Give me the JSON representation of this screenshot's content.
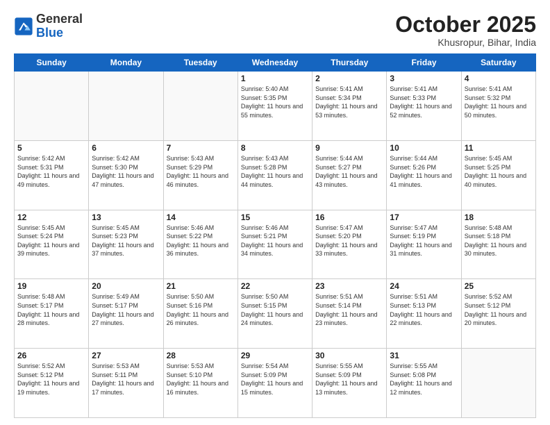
{
  "header": {
    "logo_general": "General",
    "logo_blue": "Blue",
    "month": "October 2025",
    "location": "Khusropur, Bihar, India"
  },
  "days_of_week": [
    "Sunday",
    "Monday",
    "Tuesday",
    "Wednesday",
    "Thursday",
    "Friday",
    "Saturday"
  ],
  "weeks": [
    [
      {
        "day": "",
        "info": ""
      },
      {
        "day": "",
        "info": ""
      },
      {
        "day": "",
        "info": ""
      },
      {
        "day": "1",
        "info": "Sunrise: 5:40 AM\nSunset: 5:35 PM\nDaylight: 11 hours\nand 55 minutes."
      },
      {
        "day": "2",
        "info": "Sunrise: 5:41 AM\nSunset: 5:34 PM\nDaylight: 11 hours\nand 53 minutes."
      },
      {
        "day": "3",
        "info": "Sunrise: 5:41 AM\nSunset: 5:33 PM\nDaylight: 11 hours\nand 52 minutes."
      },
      {
        "day": "4",
        "info": "Sunrise: 5:41 AM\nSunset: 5:32 PM\nDaylight: 11 hours\nand 50 minutes."
      }
    ],
    [
      {
        "day": "5",
        "info": "Sunrise: 5:42 AM\nSunset: 5:31 PM\nDaylight: 11 hours\nand 49 minutes."
      },
      {
        "day": "6",
        "info": "Sunrise: 5:42 AM\nSunset: 5:30 PM\nDaylight: 11 hours\nand 47 minutes."
      },
      {
        "day": "7",
        "info": "Sunrise: 5:43 AM\nSunset: 5:29 PM\nDaylight: 11 hours\nand 46 minutes."
      },
      {
        "day": "8",
        "info": "Sunrise: 5:43 AM\nSunset: 5:28 PM\nDaylight: 11 hours\nand 44 minutes."
      },
      {
        "day": "9",
        "info": "Sunrise: 5:44 AM\nSunset: 5:27 PM\nDaylight: 11 hours\nand 43 minutes."
      },
      {
        "day": "10",
        "info": "Sunrise: 5:44 AM\nSunset: 5:26 PM\nDaylight: 11 hours\nand 41 minutes."
      },
      {
        "day": "11",
        "info": "Sunrise: 5:45 AM\nSunset: 5:25 PM\nDaylight: 11 hours\nand 40 minutes."
      }
    ],
    [
      {
        "day": "12",
        "info": "Sunrise: 5:45 AM\nSunset: 5:24 PM\nDaylight: 11 hours\nand 39 minutes."
      },
      {
        "day": "13",
        "info": "Sunrise: 5:45 AM\nSunset: 5:23 PM\nDaylight: 11 hours\nand 37 minutes."
      },
      {
        "day": "14",
        "info": "Sunrise: 5:46 AM\nSunset: 5:22 PM\nDaylight: 11 hours\nand 36 minutes."
      },
      {
        "day": "15",
        "info": "Sunrise: 5:46 AM\nSunset: 5:21 PM\nDaylight: 11 hours\nand 34 minutes."
      },
      {
        "day": "16",
        "info": "Sunrise: 5:47 AM\nSunset: 5:20 PM\nDaylight: 11 hours\nand 33 minutes."
      },
      {
        "day": "17",
        "info": "Sunrise: 5:47 AM\nSunset: 5:19 PM\nDaylight: 11 hours\nand 31 minutes."
      },
      {
        "day": "18",
        "info": "Sunrise: 5:48 AM\nSunset: 5:18 PM\nDaylight: 11 hours\nand 30 minutes."
      }
    ],
    [
      {
        "day": "19",
        "info": "Sunrise: 5:48 AM\nSunset: 5:17 PM\nDaylight: 11 hours\nand 28 minutes."
      },
      {
        "day": "20",
        "info": "Sunrise: 5:49 AM\nSunset: 5:17 PM\nDaylight: 11 hours\nand 27 minutes."
      },
      {
        "day": "21",
        "info": "Sunrise: 5:50 AM\nSunset: 5:16 PM\nDaylight: 11 hours\nand 26 minutes."
      },
      {
        "day": "22",
        "info": "Sunrise: 5:50 AM\nSunset: 5:15 PM\nDaylight: 11 hours\nand 24 minutes."
      },
      {
        "day": "23",
        "info": "Sunrise: 5:51 AM\nSunset: 5:14 PM\nDaylight: 11 hours\nand 23 minutes."
      },
      {
        "day": "24",
        "info": "Sunrise: 5:51 AM\nSunset: 5:13 PM\nDaylight: 11 hours\nand 22 minutes."
      },
      {
        "day": "25",
        "info": "Sunrise: 5:52 AM\nSunset: 5:12 PM\nDaylight: 11 hours\nand 20 minutes."
      }
    ],
    [
      {
        "day": "26",
        "info": "Sunrise: 5:52 AM\nSunset: 5:12 PM\nDaylight: 11 hours\nand 19 minutes."
      },
      {
        "day": "27",
        "info": "Sunrise: 5:53 AM\nSunset: 5:11 PM\nDaylight: 11 hours\nand 17 minutes."
      },
      {
        "day": "28",
        "info": "Sunrise: 5:53 AM\nSunset: 5:10 PM\nDaylight: 11 hours\nand 16 minutes."
      },
      {
        "day": "29",
        "info": "Sunrise: 5:54 AM\nSunset: 5:09 PM\nDaylight: 11 hours\nand 15 minutes."
      },
      {
        "day": "30",
        "info": "Sunrise: 5:55 AM\nSunset: 5:09 PM\nDaylight: 11 hours\nand 13 minutes."
      },
      {
        "day": "31",
        "info": "Sunrise: 5:55 AM\nSunset: 5:08 PM\nDaylight: 11 hours\nand 12 minutes."
      },
      {
        "day": "",
        "info": ""
      }
    ]
  ]
}
